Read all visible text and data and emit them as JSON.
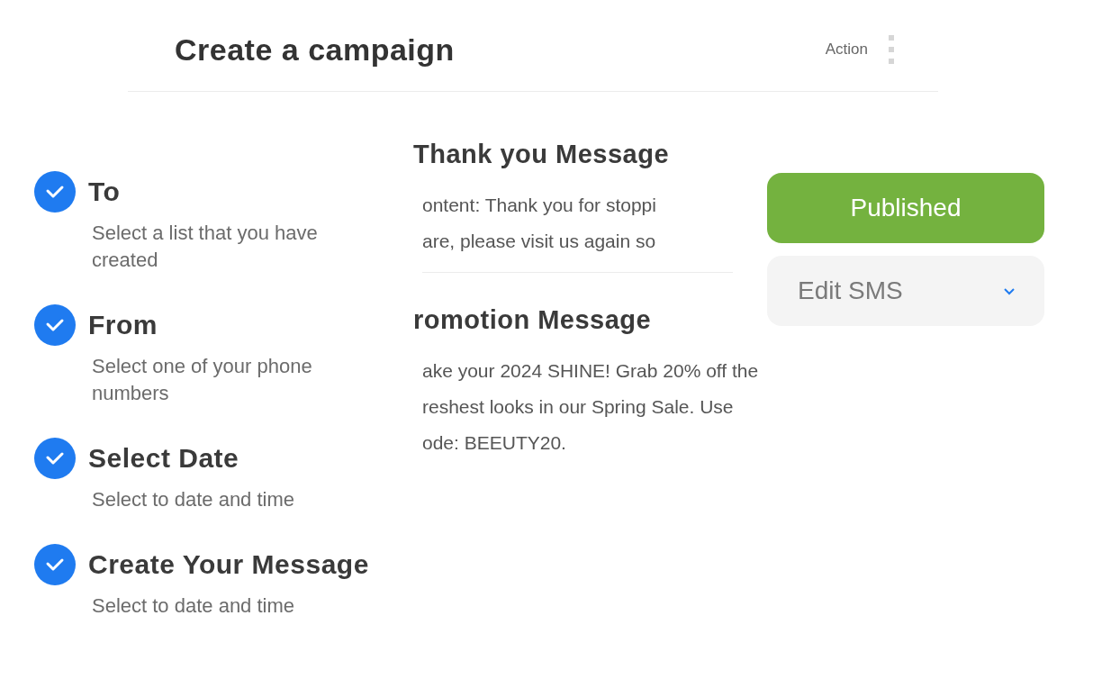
{
  "header": {
    "title": "Create a campaign",
    "action": "Action"
  },
  "steps": [
    {
      "title": "To",
      "description": "Select a list that you have created",
      "checked": true
    },
    {
      "title": "From",
      "description": "Select one of your phone numbers",
      "checked": true
    },
    {
      "title": "Select Date",
      "description": "Select to date and time",
      "checked": true
    },
    {
      "title": "Create Your Message",
      "description": "Select to date and time",
      "checked": true
    }
  ],
  "messages": [
    {
      "title": "Thank you Message",
      "lines": [
        "ontent: Thank you for stoppi",
        "are, please visit us again so"
      ]
    },
    {
      "title": "romotion Message",
      "lines": [
        "ake your 2024 SHINE! Grab 20% off the",
        "reshest looks in our  Spring Sale. Use",
        "ode: BEEUTY20."
      ]
    }
  ],
  "status_button": "Published",
  "edit_dropdown": "Edit SMS"
}
